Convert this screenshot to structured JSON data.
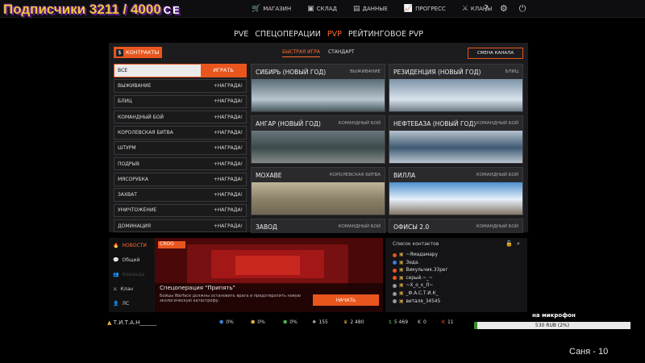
{
  "overlay": {
    "subscribers": "Подписчики 3211 / 4000",
    "logo_tail": "CE"
  },
  "topnav": [
    {
      "label": "МАГАЗИН",
      "icon": "cart-icon"
    },
    {
      "label": "СКЛАД",
      "icon": "box-icon"
    },
    {
      "label": "ДАННЫЕ",
      "icon": "data-icon"
    },
    {
      "label": "ПРОГРЕСС",
      "icon": "chart-icon"
    },
    {
      "label": "КЛАНЫ",
      "icon": "swords-icon"
    }
  ],
  "mode_tabs": [
    {
      "label": "PVE",
      "active": false
    },
    {
      "label": "СПЕЦОПЕРАЦИИ",
      "active": false
    },
    {
      "label": "PVP",
      "active": true
    },
    {
      "label": "РЕЙТИНГОВОЕ PVP",
      "active": false
    }
  ],
  "contracts": {
    "badge": "$",
    "label": "КОНТРАКТЫ"
  },
  "subtabs": [
    {
      "label": "БЫСТРАЯ ИГРА",
      "active": true
    },
    {
      "label": "СТАНДАРТ",
      "active": false
    }
  ],
  "change_channel": "СМЕНА КАНАЛА",
  "mode_list": [
    {
      "label": "ВСЕ",
      "action": "ИГРАТЬ",
      "selected": true
    },
    {
      "label": "ВЫЖИВАНИЕ",
      "action": "+НАГРАДА!"
    },
    {
      "label": "БЛИЦ",
      "action": "+НАГРАДА!"
    },
    {
      "label": "КОМАНДНЫЙ БОЙ",
      "action": "+НАГРАДА!"
    },
    {
      "label": "КОРОЛЕВСКАЯ БИТВА",
      "action": "+НАГРАДА!"
    },
    {
      "label": "ШТУРМ",
      "action": "+НАГРАДА!"
    },
    {
      "label": "ПОДРЫВ",
      "action": "+НАГРАДА!"
    },
    {
      "label": "МЯСОРУБКА",
      "action": "+НАГРАДА!"
    },
    {
      "label": "ЗАХВАТ",
      "action": "+НАГРАДА!"
    },
    {
      "label": "УНИЧТОЖЕНИЕ",
      "action": "+НАГРАДА!"
    },
    {
      "label": "ДОМИНАЦИЯ",
      "action": "+НАГРАДА!"
    }
  ],
  "maps": [
    {
      "name": "СИБИРЬ (НОВЫЙ ГОД)",
      "mode": "ВЫЖИВАНИЕ"
    },
    {
      "name": "РЕЗИДЕНЦИЯ (НОВЫЙ ГОД)",
      "mode": "БЛИЦ"
    },
    {
      "name": "АНГАР (НОВЫЙ ГОД)",
      "mode": "КОМАНДНЫЙ БОЙ"
    },
    {
      "name": "НЕФТЕБАЗА (НОВЫЙ ГОД)",
      "mode": "КОМАНДНЫЙ БОЙ"
    },
    {
      "name": "МОХАВЕ",
      "mode": "КОРОЛЕВСКАЯ БИТВА"
    },
    {
      "name": "ВИЛЛА",
      "mode": "КОМАНДНЫЙ БОЙ"
    },
    {
      "name": "ЗАВОД",
      "mode": "КОМАНДНЫЙ БОЙ"
    },
    {
      "name": "ОФИСЫ 2.0",
      "mode": "КОМАНДНЫЙ БОЙ"
    }
  ],
  "news_nav": [
    {
      "label": "НОВОСТИ",
      "icon": "flame-icon",
      "active": true
    },
    {
      "label": "Общий",
      "icon": "chat-icon"
    },
    {
      "label": "Команда",
      "icon": "team-icon",
      "dim": true
    },
    {
      "label": "Клан",
      "icon": "clan-icon"
    },
    {
      "label": "ЛС",
      "icon": "person-icon"
    }
  ],
  "news": {
    "tag": "CROO",
    "title": "Спецоперация \"Припять\"",
    "desc": "Бойцы Warface должны остановить врага и предотвратить новую экологическую катастрофу.",
    "start": "НАЧАТЬ"
  },
  "contacts": {
    "title": "Список контактов",
    "items": [
      {
        "name": "~Ямадамару",
        "status": "#e8561e"
      },
      {
        "name": "Зеда.",
        "status": "#3b82d6"
      },
      {
        "name": "Викульчик.33рег",
        "status": "#e8561e"
      },
      {
        "name": "серый.~_~",
        "status": "#e8561e"
      },
      {
        "name": "~Х_о_х_Л~",
        "status": "#999999"
      },
      {
        "name": "_Ф.А.С.Т.И.К_",
        "status": "#999999"
      },
      {
        "name": "виталя_34545",
        "status": "#999999"
      }
    ]
  },
  "status": {
    "player": "Т.И.Т.А.Н______",
    "stats": [
      {
        "icon": "blue-booster-icon",
        "value": "0%",
        "color": "#3b82d6"
      },
      {
        "icon": "gold-booster-icon",
        "value": "0%",
        "color": "#e0b040"
      },
      {
        "icon": "green-booster-icon",
        "value": "0%",
        "color": "#4caf50"
      },
      {
        "icon": "wings-icon",
        "value": "155",
        "color": "#cccccc"
      },
      {
        "icon": "crown-icon",
        "value": "2 480",
        "color": "#e0b040"
      },
      {
        "icon": "dollar-icon",
        "value": "5 469",
        "color": "#4caf50"
      },
      {
        "icon": "kredit-icon",
        "value": "0",
        "color": "#cccccc"
      },
      {
        "icon": "k-icon",
        "value": "11",
        "color": "#e8561e"
      }
    ]
  },
  "donation": {
    "mic": "на микрофон",
    "progress_text": "530 RUB (2%)",
    "progress": 0.02
  },
  "footer_caption": "Саня - 10"
}
